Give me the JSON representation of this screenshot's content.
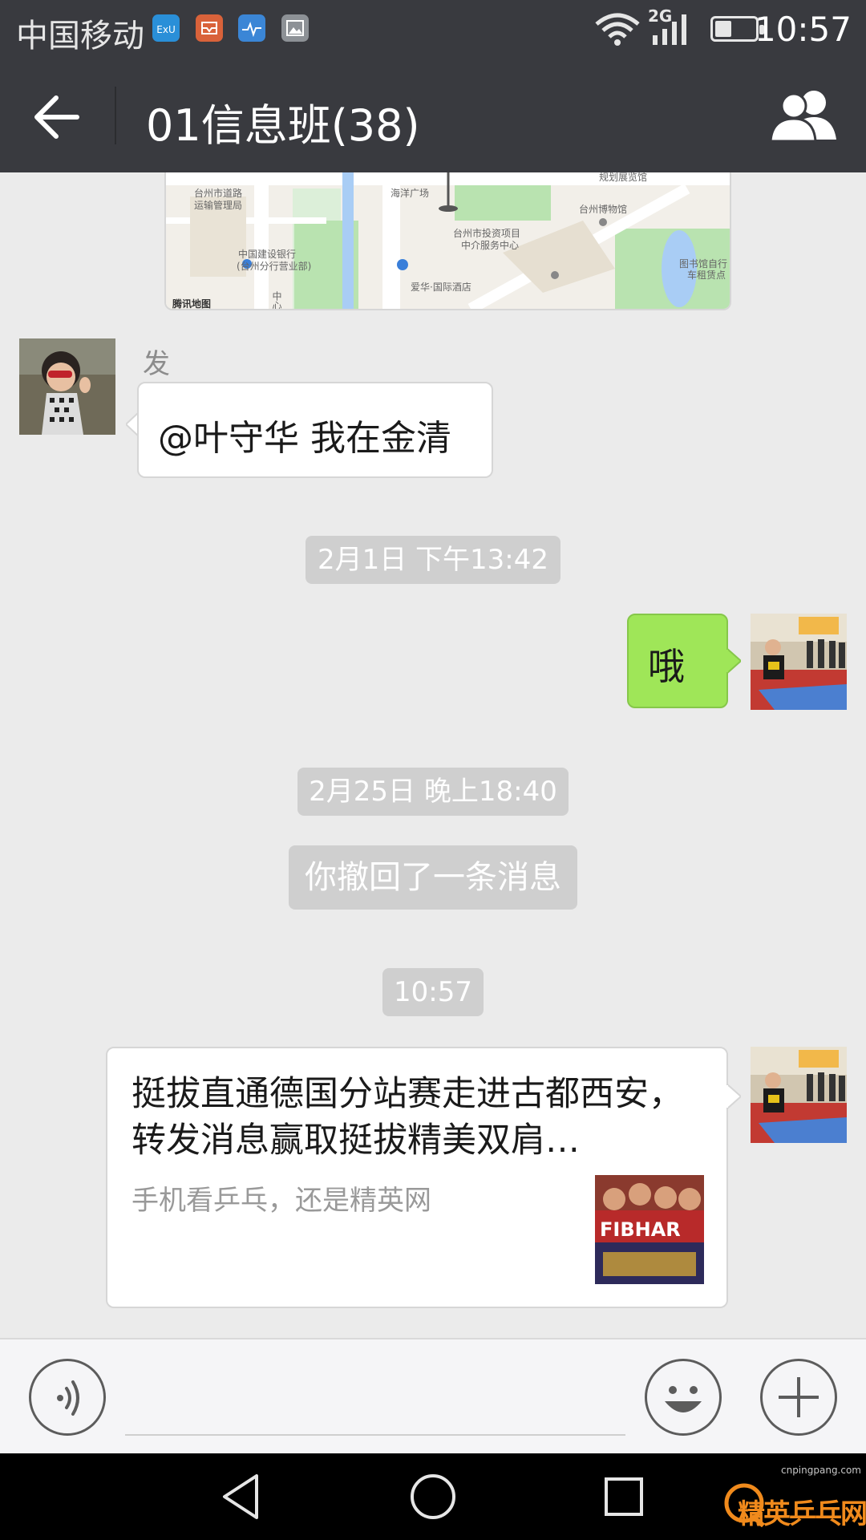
{
  "status_bar": {
    "carrier": "中国移动",
    "network": "2G",
    "time": "10:57",
    "app_icons": [
      "app-blue-icon",
      "mail-icon",
      "health-icon",
      "gallery-icon"
    ]
  },
  "header": {
    "title": "01信息班(38)",
    "back_icon": "back-arrow-icon",
    "members_icon": "group-members-icon"
  },
  "map": {
    "labels": [
      "台州市道路",
      "运输管理局",
      "海洋广场",
      "规划展览馆",
      "台州博物馆",
      "台州市投资项目",
      "中介服务中心",
      "中国建设银行",
      "(台州分行营业部)",
      "爱华·国际酒店",
      "图书馆自行",
      "车租赁点",
      "腾讯地图",
      "中心大"
    ]
  },
  "messages": {
    "m1": {
      "sender_name": "发",
      "text": "@叶守华 我在金清"
    },
    "t1": "2月1日 下午13:42",
    "m2": {
      "text": "哦"
    },
    "t2": "2月25日 晚上18:40",
    "recall": "你撤回了一条消息",
    "t3": "10:57",
    "link": {
      "title": "挺拔直通德国分站赛走进古都西安，转发消息赢取挺拔精美双肩…",
      "desc": "手机看乒乓，还是精英网",
      "thumb_text": "FIBHAR"
    }
  },
  "input_bar": {
    "voice_icon": "voice-icon",
    "emoji_icon": "emoji-icon",
    "plus_icon": "plus-icon"
  },
  "nav_bar": {
    "back_icon": "nav-back-icon",
    "home_icon": "nav-home-icon",
    "recents_icon": "nav-recents-icon"
  },
  "watermark": {
    "text": "精英乒乓网",
    "url": "cnpingpang.com"
  },
  "colors": {
    "bar_dark": "#393a3f",
    "chat_bg": "#ebebeb",
    "my_bubble": "#9fe658",
    "system_pill": "#cfcfcf"
  }
}
